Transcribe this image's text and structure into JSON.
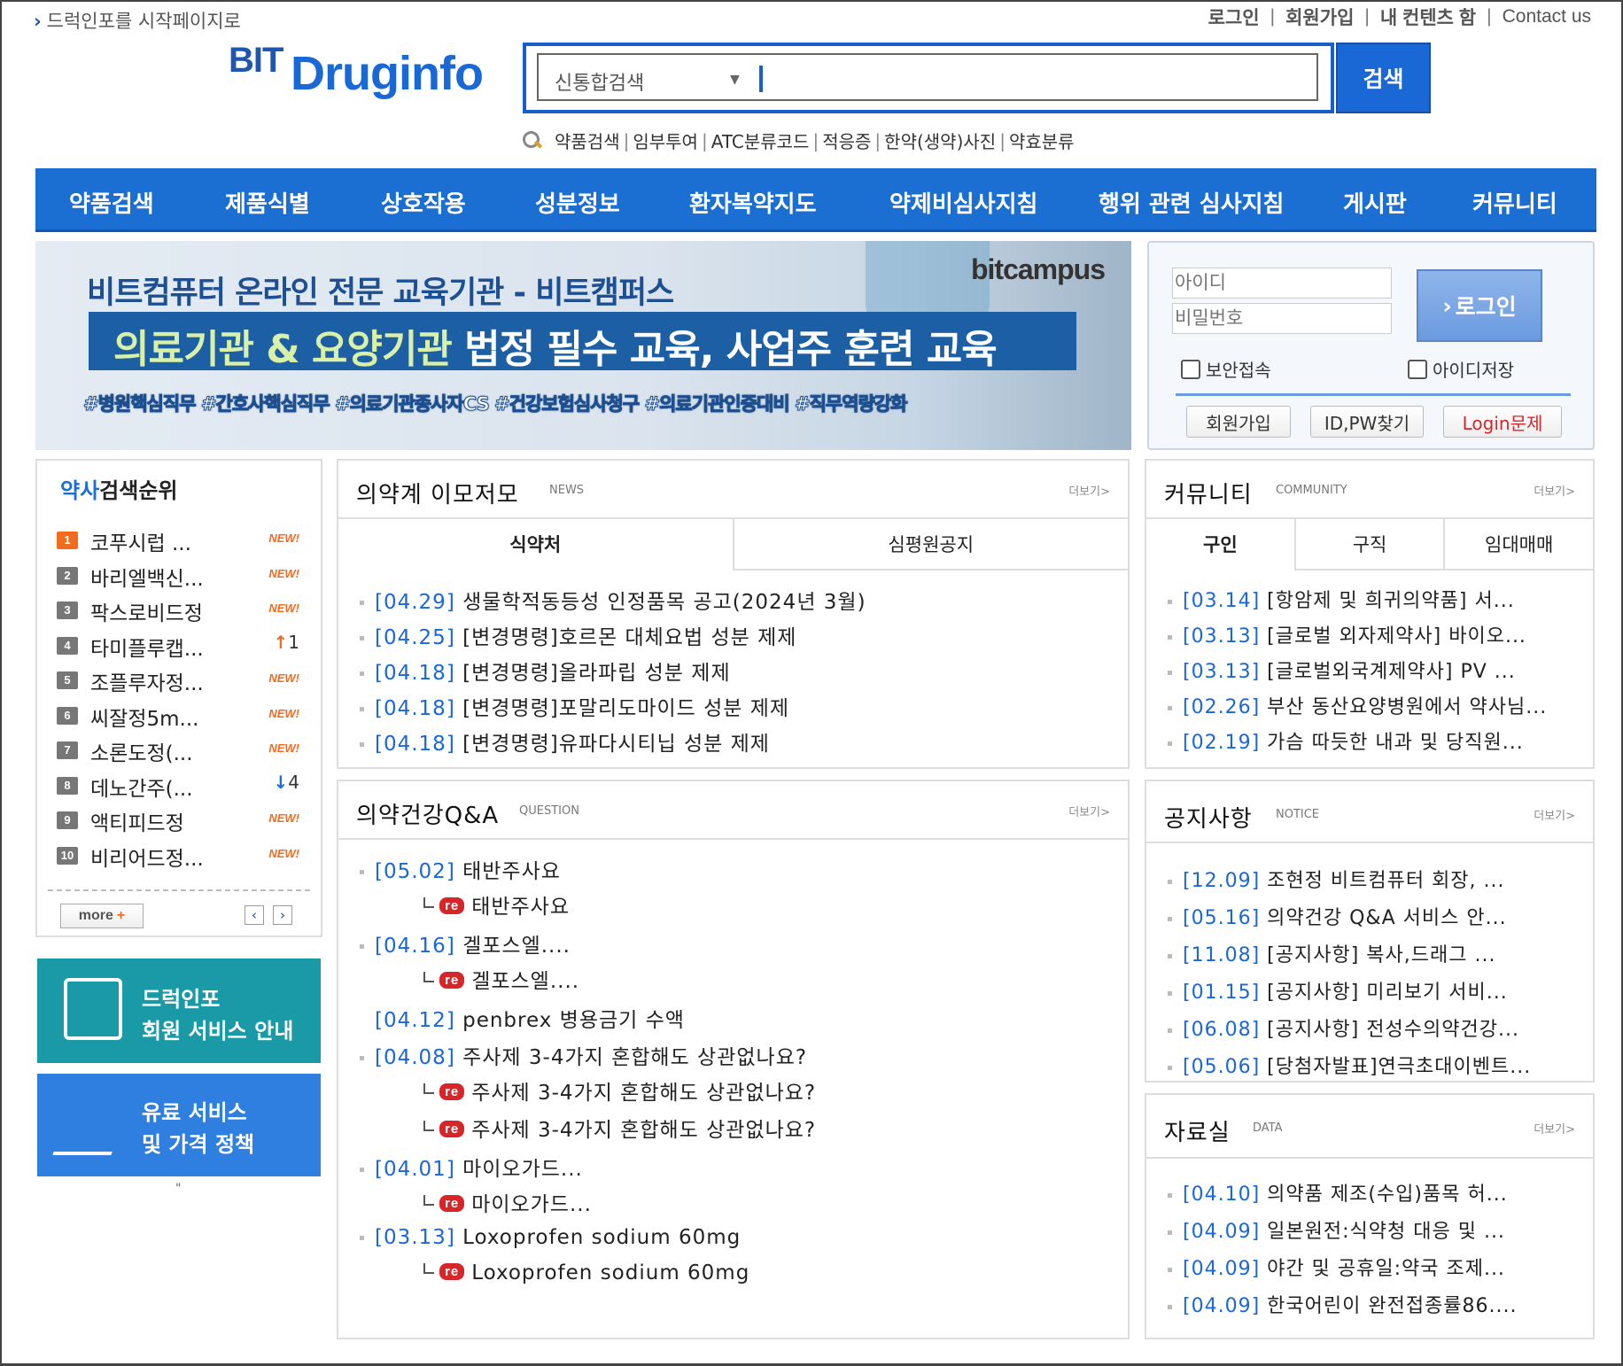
{
  "top": {
    "start_page_link": "드럭인포를 시작페이지로"
  },
  "util_links": [
    "로그인",
    "회원가입",
    "내 컨텐츠 함",
    "Contact us"
  ],
  "logo": {
    "bit": "BIT",
    "druginfo": "Druginfo"
  },
  "search": {
    "category": "신통합검색",
    "button": "검색"
  },
  "quick_links": [
    "약품검색",
    "임부투여",
    "ATC분류코드",
    "적응증",
    "한약(생약)사진",
    "약효분류"
  ],
  "nav": [
    "약품검색",
    "제품식별",
    "상호작용",
    "성분정보",
    "환자복약지도",
    "약제비심사지침",
    "행위 관련 심사지침",
    "게시판",
    "커뮤니티"
  ],
  "banner": {
    "brand": "bitcampus",
    "line1": "비트컴퓨터 온라인 전문 교육기관 - 비트캠퍼스",
    "line2_highlight": "의료기관 & 요양기관",
    "line2_rest": " 법정 필수 교육, 사업주 훈련 교육",
    "line3": "#병원핵심직무 #간호사핵심직무 #의료기관종사자CS #건강보험심사청구 #의료기관인증대비 #직무역량강화"
  },
  "login": {
    "id_placeholder": "아이디",
    "pw_placeholder": "비밀번호",
    "login_button": "로그인",
    "secure_label": "보안접속",
    "save_id_label": "아이디저장",
    "join": "회원가입",
    "find": "ID,PW찾기",
    "problem": "Login문제"
  },
  "rank": {
    "title_highlight": "약사",
    "title_rest": "검색순위",
    "items": [
      {
        "num": "1",
        "name": "코푸시럽 ...",
        "status": "NEW!"
      },
      {
        "num": "2",
        "name": "바리엘백신...",
        "status": "NEW!"
      },
      {
        "num": "3",
        "name": "팍스로비드정",
        "status": "NEW!"
      },
      {
        "num": "4",
        "name": "타미플루캡...",
        "status": "↑",
        "change": "1"
      },
      {
        "num": "5",
        "name": "조플루자정...",
        "status": "NEW!"
      },
      {
        "num": "6",
        "name": "씨잘정5m...",
        "status": "NEW!"
      },
      {
        "num": "7",
        "name": "소론도정(...",
        "status": "NEW!"
      },
      {
        "num": "8",
        "name": "데노간주(...",
        "status": "↓",
        "change": "4"
      },
      {
        "num": "9",
        "name": "액티피드정",
        "status": "NEW!"
      },
      {
        "num": "10",
        "name": "비리어드정...",
        "status": "NEW!"
      }
    ],
    "more": "more",
    "more_plus": "+"
  },
  "promo1": {
    "line1": "드럭인포",
    "line2": "회원 서비스 안내",
    "color": "#1a9aa6"
  },
  "promo2": {
    "line1": "유료 서비스",
    "line2": "및 가격 정책",
    "color": "#2f7fe0"
  },
  "promo_footnote": "\"",
  "news": {
    "title": "의약계 이모저모",
    "sub": "NEWS",
    "more": "더보기>",
    "tabs": [
      "식약처",
      "심평원공지"
    ],
    "items": [
      {
        "date": "[04.29]",
        "text": "생물학적동등성 인정품목 공고(2024년 3월)"
      },
      {
        "date": "[04.25]",
        "text": "[변경명령]호르몬 대체요법 성분 제제"
      },
      {
        "date": "[04.18]",
        "text": "[변경명령]올라파립 성분 제제"
      },
      {
        "date": "[04.18]",
        "text": "[변경명령]포말리도마이드 성분 제제"
      },
      {
        "date": "[04.18]",
        "text": "[변경명령]유파다시티닙 성분 제제"
      }
    ]
  },
  "community": {
    "title": "커뮤니티",
    "sub": "COMMUNITY",
    "more": "더보기>",
    "tabs": [
      "구인",
      "구직",
      "임대매매"
    ],
    "items": [
      {
        "date": "[03.14]",
        "text": "[항암제 및 희귀의약품] 서..."
      },
      {
        "date": "[03.13]",
        "text": "[글로벌 외자제약사] 바이오..."
      },
      {
        "date": "[03.13]",
        "text": "[글로벌외국계제약사] PV ..."
      },
      {
        "date": "[02.26]",
        "text": "부산 동산요양병원에서 약사님..."
      },
      {
        "date": "[02.19]",
        "text": "가슴 따듯한 내과 및 당직원..."
      }
    ]
  },
  "qa": {
    "title": "의약건강Q&A",
    "sub": "QUESTION",
    "more": "더보기>",
    "re_tag": "re",
    "items": [
      {
        "date": "[05.02]",
        "text": "태반주사요",
        "reply": "태반주사요"
      },
      {
        "date": "[04.16]",
        "text": "겔포스엘....",
        "reply": "겔포스엘...."
      },
      {
        "date": "[04.12]",
        "text": "penbrex 병용금기 수액"
      },
      {
        "date": "[04.08]",
        "text": "주사제 3-4가지 혼합해도 상관없나요?",
        "reply": "주사제 3-4가지 혼합해도 상관없나요?",
        "reply2": "주사제 3-4가지 혼합해도 상관없나요?"
      },
      {
        "date": "[04.01]",
        "text": "마이오가드...",
        "reply": "마이오가드..."
      },
      {
        "date": "[03.13]",
        "text": "Loxoprofen sodium 60mg",
        "reply": "Loxoprofen sodium 60mg"
      }
    ]
  },
  "notice": {
    "title": "공지사항",
    "sub": "NOTICE",
    "more": "더보기>",
    "items": [
      {
        "date": "[12.09]",
        "text": "조현정 비트컴퓨터 회장, ..."
      },
      {
        "date": "[05.16]",
        "text": "의약건강 Q&A 서비스 안..."
      },
      {
        "date": "[11.08]",
        "text": "[공지사항] 복사,드래그 ..."
      },
      {
        "date": "[01.15]",
        "text": "[공지사항] 미리보기 서비..."
      },
      {
        "date": "[06.08]",
        "text": "[공지사항] 전성수의약건강..."
      },
      {
        "date": "[05.06]",
        "text": "[당첨자발표]연극초대이벤트..."
      }
    ]
  },
  "data_room": {
    "title": "자료실",
    "sub": "DATA",
    "more": "더보기>",
    "items": [
      {
        "date": "[04.10]",
        "text": "의약품 제조(수입)품목 허..."
      },
      {
        "date": "[04.09]",
        "text": "일본원전:식약청 대응 및 ..."
      },
      {
        "date": "[04.09]",
        "text": "야간 및 공휴일:약국 조제..."
      },
      {
        "date": "[04.09]",
        "text": "한국어린이 완전접종률86...."
      }
    ]
  }
}
